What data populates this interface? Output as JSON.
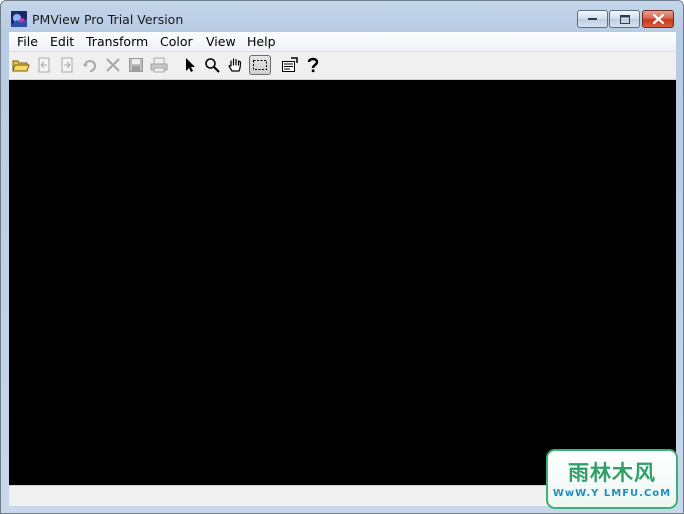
{
  "window": {
    "title": "PMView Pro Trial Version",
    "controls": {
      "minimize": "minimize",
      "maximize": "maximize",
      "close": "close"
    }
  },
  "menu": {
    "items": [
      {
        "label": "File"
      },
      {
        "label": "Edit"
      },
      {
        "label": "Transform"
      },
      {
        "label": "Color"
      },
      {
        "label": "View"
      },
      {
        "label": "Help"
      }
    ]
  },
  "toolbar": {
    "buttons": [
      {
        "icon": "open-folder-icon",
        "enabled": true
      },
      {
        "icon": "import-icon",
        "enabled": false
      },
      {
        "icon": "export-icon",
        "enabled": false
      },
      {
        "icon": "rotate-icon",
        "enabled": false
      },
      {
        "icon": "delete-icon",
        "enabled": false
      },
      {
        "icon": "save-icon",
        "enabled": false
      },
      {
        "icon": "print-icon",
        "enabled": false
      },
      {
        "icon": "pointer-icon",
        "enabled": true
      },
      {
        "icon": "zoom-icon",
        "enabled": true
      },
      {
        "icon": "hand-icon",
        "enabled": true
      },
      {
        "icon": "select-rectangle-icon",
        "enabled": true,
        "pressed": true
      },
      {
        "icon": "properties-icon",
        "enabled": true
      },
      {
        "icon": "help-icon",
        "enabled": true
      }
    ]
  },
  "canvas": {
    "background": "#000000"
  },
  "watermark": {
    "title": "雨林木风",
    "url": "WwW.Y LMFU.CoM"
  },
  "colors": {
    "canvas": "#000000",
    "close_button": "#c5391d",
    "watermark_green": "#2fa06a",
    "watermark_blue": "#1f8ec8"
  }
}
